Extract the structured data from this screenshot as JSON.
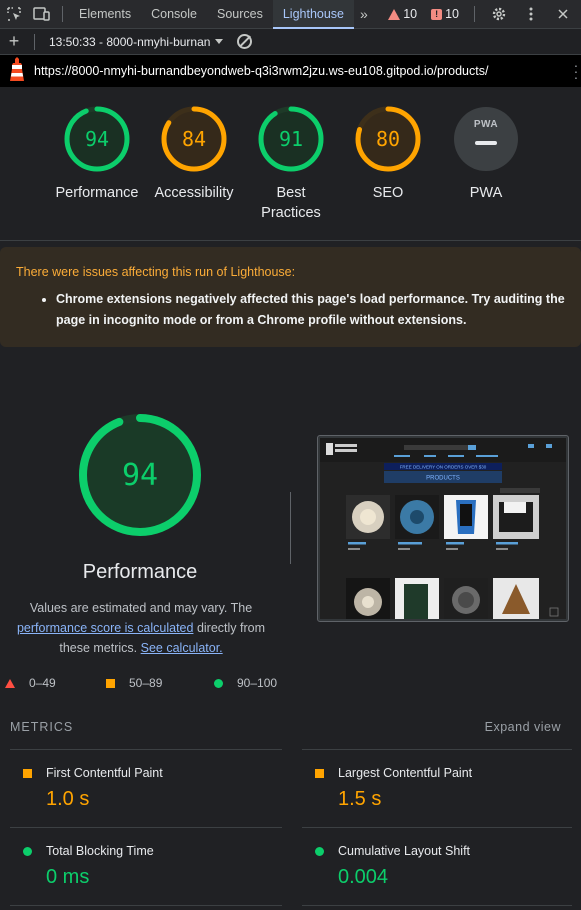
{
  "devtools": {
    "tabs": [
      "Elements",
      "Console",
      "Sources",
      "Lighthouse"
    ],
    "active_tab": "Lighthouse",
    "warnings_count": "10",
    "errors_count": "10"
  },
  "toolbar": {
    "report_label": "13:50:33 - 8000-nmyhi-burnan"
  },
  "url": "https://8000-nmyhi-burnandbeyondweb-q3i3rwm2jzu.ws-eu108.gitpod.io/products/",
  "scores": [
    {
      "label": "Performance",
      "value": "94",
      "score": 0.94,
      "color": "#0cce6b"
    },
    {
      "label": "Accessibility",
      "value": "84",
      "score": 0.84,
      "color": "#ffa400"
    },
    {
      "label": "Best Practices",
      "value": "91",
      "score": 0.91,
      "color": "#0cce6b"
    },
    {
      "label": "SEO",
      "value": "80",
      "score": 0.8,
      "color": "#ffa400"
    }
  ],
  "pwa": {
    "label": "PWA",
    "badge": "PWA"
  },
  "warning": {
    "title": "There were issues affecting this run of Lighthouse:",
    "items": [
      "Chrome extensions negatively affected this page's load performance. Try auditing the page in incognito mode or from a Chrome profile without extensions."
    ]
  },
  "performance": {
    "score": "94",
    "title": "Performance",
    "desc_1": "Values are estimated and may vary. The",
    "desc_link": "performance score is calculated",
    "desc_2": "directly from these metrics.",
    "calc_link": "See calculator."
  },
  "legend": {
    "fail": "0–49",
    "average": "50–89",
    "pass": "90–100"
  },
  "metrics": {
    "heading": "METRICS",
    "expand": "Expand view",
    "items": [
      {
        "name": "First Contentful Paint",
        "value": "1.0 s",
        "status": "average"
      },
      {
        "name": "Largest Contentful Paint",
        "value": "1.5 s",
        "status": "average"
      },
      {
        "name": "Total Blocking Time",
        "value": "0 ms",
        "status": "pass"
      },
      {
        "name": "Cumulative Layout Shift",
        "value": "0.004",
        "status": "pass"
      }
    ]
  },
  "thumbnail": {
    "banner": "FREE DELIVERY ON ORDERS OVER $30",
    "heading": "PRODUCTS"
  },
  "colors": {
    "pass": "#0cce6b",
    "average": "#ffa400",
    "fail": "#ff4e42",
    "accent": "#a8c7fa"
  }
}
